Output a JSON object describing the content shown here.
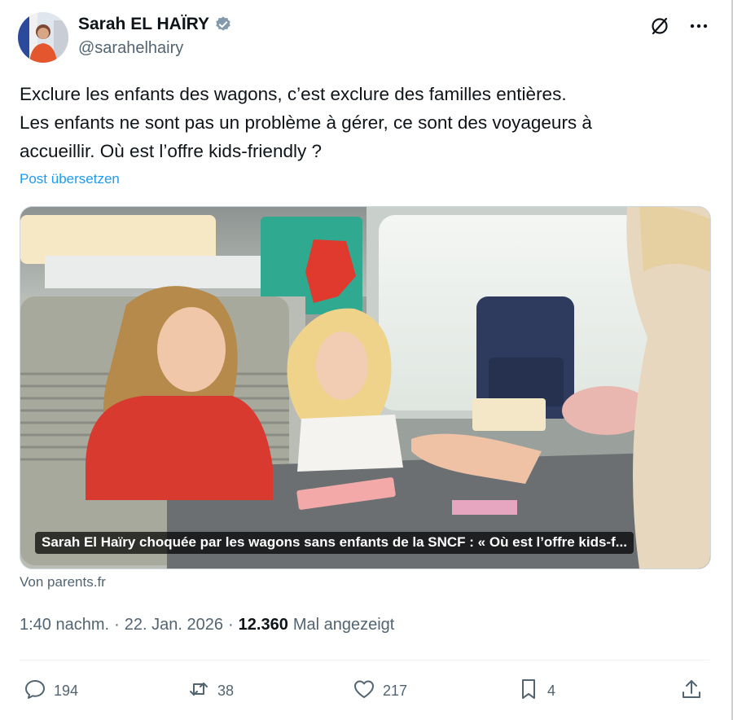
{
  "author": {
    "name": "Sarah EL HAÏRY",
    "handle": "@sarahelhairy",
    "verified": true
  },
  "post": {
    "text_lines": [
      "Exclure les enfants des wagons, c’est exclure des familles entières.",
      "Les enfants ne sont pas un problème à gérer, ce sont des voyageurs à",
      "accueillir. Où est l’offre kids-friendly ?"
    ],
    "translate_label": "Post übersetzen"
  },
  "card": {
    "caption": "Sarah El Haïry choquée par les wagons sans enfants de la SNCF : « Où est l’offre kids-f...",
    "source": "Von parents.fr"
  },
  "meta": {
    "time": "1:40 nachm.",
    "sep1": "·",
    "date": "22. Jan. 2026",
    "sep2": "·",
    "views": "12.360",
    "views_label": "Mal angezeigt"
  },
  "stats": {
    "replies": "194",
    "reposts": "38",
    "likes": "217",
    "bookmarks": "4"
  },
  "icons": {
    "verified": "verified-badge-icon",
    "grok": "slashed-circle-icon",
    "more": "more-dots-icon",
    "reply": "reply-icon",
    "repost": "repost-icon",
    "like": "heart-icon",
    "bookmark": "bookmark-icon",
    "share": "share-icon"
  },
  "colors": {
    "link": "#1d9bf0",
    "secondary_text": "#536471",
    "verified": "#829aab"
  }
}
